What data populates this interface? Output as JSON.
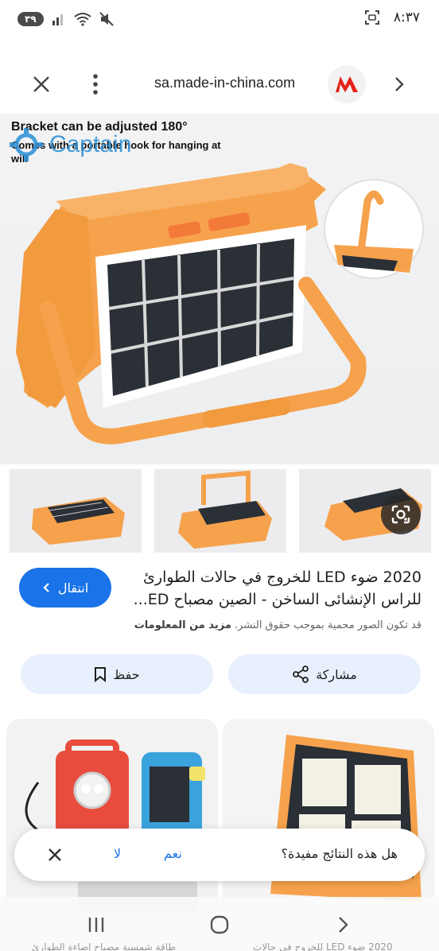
{
  "status_bar": {
    "battery": "٣٩",
    "time": "٨:٣٧"
  },
  "browser": {
    "url": "sa.made-in-china.com",
    "site_logo_letter": "M"
  },
  "hero": {
    "caption_line1": "Bracket can be adjusted 180°",
    "caption_line2": "Comes with a portable hook for hanging at",
    "caption_line3": "will",
    "watermark": "Captain"
  },
  "result": {
    "title_line1": "2020 ضوء LED للخروج في حالات الطوارئ",
    "title_line2": "للراس الإنشائى الساخن - الصين مصباح ED...",
    "visit_label": "انتقال",
    "copyright_text": "قد تكون الصور محمية بموجب حقوق النشر.",
    "more_info": "مزيد من المعلومات"
  },
  "actions": {
    "share_label": "مشاركة",
    "save_label": "حفظ"
  },
  "feedback": {
    "question": "هل هذه النتائج مفيدة؟",
    "yes": "نعم",
    "no": "لا"
  },
  "peek": {
    "left_snippet": "طاقة شمسية مصباح إضاءة الطوارئ",
    "right_snippet": "2020 ضوء LED للخروج في حالات"
  },
  "colors": {
    "accent": "#1a73e8",
    "chip_bg": "#e8f0fe",
    "product_orange": "#f5a04a"
  }
}
